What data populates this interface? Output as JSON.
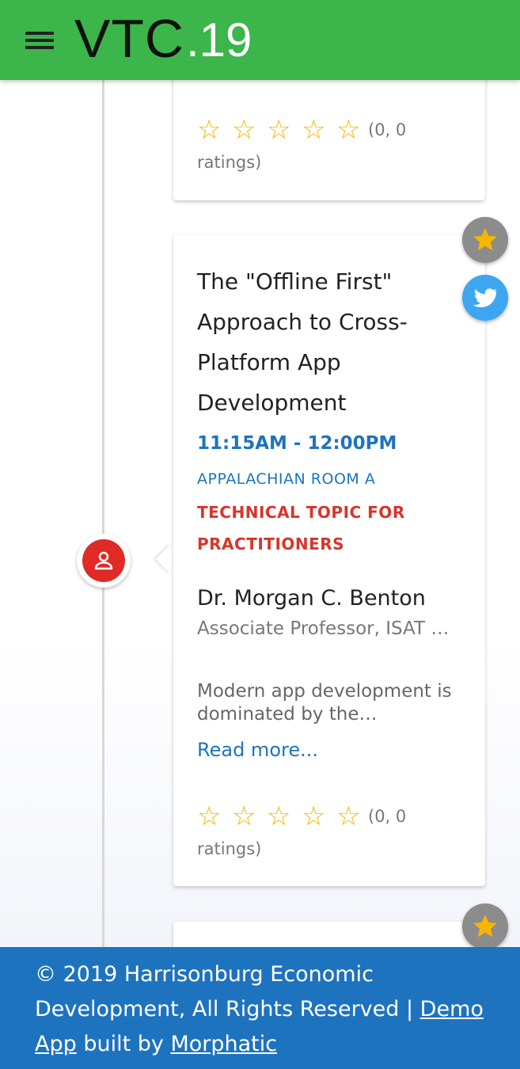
{
  "header": {
    "logo_main": "VTC",
    "logo_year": ".19",
    "menu_icon": "hamburger-menu-icon"
  },
  "sessions": {
    "previous": {
      "rating_text": "(0, 0 ratings)"
    },
    "current": {
      "title": "The \"Offline First\" Approach to Cross-Platform App Development",
      "time": "11:15AM - 12:00PM",
      "room": "APPALACHIAN ROOM A",
      "topic": "TECHNICAL TOPIC FOR PRACTITIONERS",
      "speaker_name": "Dr. Morgan C. Benton",
      "speaker_title": "Associate Professor, ISAT …",
      "description": "Modern app development is dominated by the…",
      "read_more": "Read more...",
      "rating_text": "(0, 0 ratings)"
    }
  },
  "icons": {
    "star": "star-icon",
    "twitter": "twitter-icon",
    "person": "person-icon"
  },
  "colors": {
    "header_bg": "#3cb54a",
    "footer_bg": "#1e73be",
    "accent_blue": "#1e73be",
    "topic_red": "#d9342b",
    "star_yellow": "#f7b500",
    "twitter_blue": "#3ea6f0"
  },
  "footer": {
    "text": "© 2019 Harrisonburg Economic Development, All Rights Reserved | ",
    "demo_app_link": "Demo App",
    "built_by": " built by ",
    "morphatic_link": "Morphatic"
  }
}
